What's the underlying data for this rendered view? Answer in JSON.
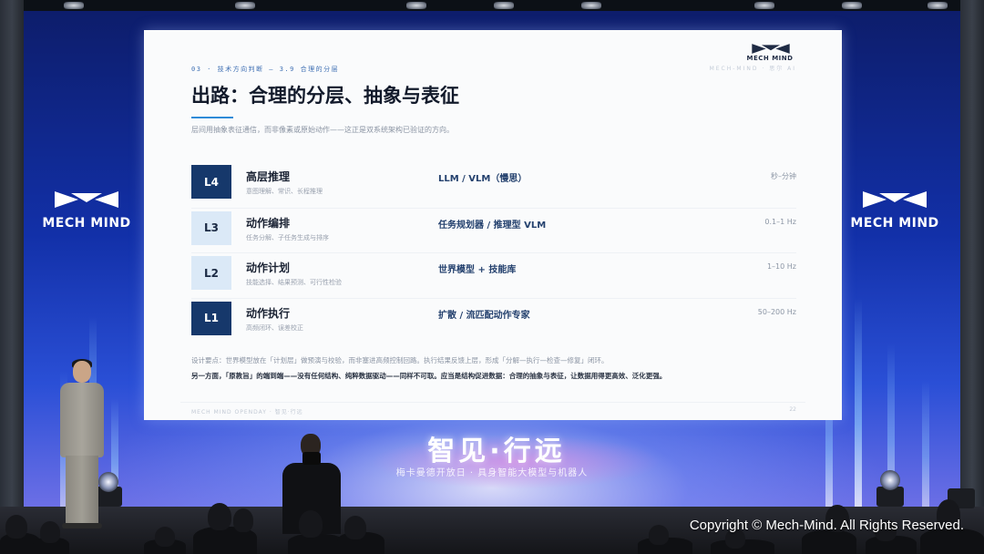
{
  "side_logo": {
    "wordmark": "MECH MIND"
  },
  "slide": {
    "breadcrumb": "03 · 技术方向判断 — 3.9 合理的分层",
    "brand_wordmark": "MECH MIND",
    "brand_faint": "MECH-MIND · 思尔 AI",
    "title": "出路：合理的分层、抽象与表征",
    "subtitle": "层间用抽象表征通信，而非像素或原始动作——这正是双系统架构已验证的方向。",
    "layers": [
      {
        "badge": "L4",
        "name": "高层推理",
        "desc": "意图理解、常识、长程推理",
        "tech": "LLM / VLM（慢思）",
        "rate": "秒–分钟",
        "style": "dark"
      },
      {
        "badge": "L3",
        "name": "动作编排",
        "desc": "任务分解、子任务生成与排序",
        "tech": "任务规划器 / 推理型 VLM",
        "rate": "0.1–1 Hz",
        "style": "light"
      },
      {
        "badge": "L2",
        "name": "动作计划",
        "desc": "技能选择、结果预测、可行性检验",
        "tech": "世界模型 + 技能库",
        "rate": "1–10 Hz",
        "style": "light"
      },
      {
        "badge": "L1",
        "name": "动作执行",
        "desc": "高频闭环、误差校正",
        "tech": "扩散 / 流匹配动作专家",
        "rate": "50–200 Hz",
        "style": "dark"
      }
    ],
    "note_design": "设计要点：世界模型放在「计划层」做预演与校验，而非塞进高频控制回路。执行结果反馈上层，形成「分解—执行—检查—修复」闭环。",
    "note_conclusion": "另一方面，「原教旨」的端到端——没有任何结构、纯粹数据驱动——同样不可取。应当是结构促进数据：合理的抽象与表征，让数据用得更高效、泛化更强。",
    "footer": "MECH MIND OPENDAY · 智见·行远",
    "page_number": "22"
  },
  "event": {
    "title": "智见·行远",
    "subtitle": "梅卡曼德开放日 · 具身智能大模型与机器人"
  },
  "copyright": "Copyright © Mech-Mind. All Rights Reserved.",
  "colors": {
    "slide_bg": "#fafbfc",
    "badge_dark": "#16386b",
    "badge_light": "#dbe9f7",
    "accent": "#2e8bd8",
    "led_wall": "#1230a8"
  }
}
